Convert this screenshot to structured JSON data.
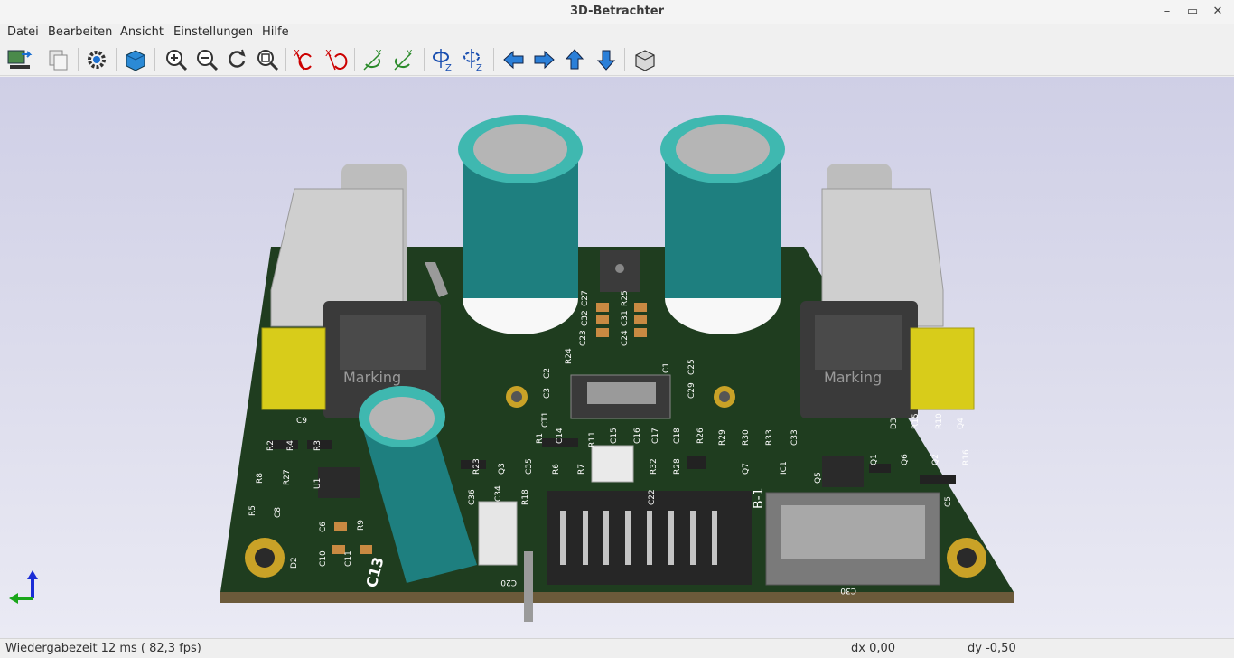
{
  "window": {
    "title": "3D-Betrachter"
  },
  "menu": [
    "Datei",
    "Bearbeiten",
    "Ansicht",
    "Einstellungen",
    "Hilfe"
  ],
  "toolbar": {
    "buttons": [
      "reload-board-icon",
      "copy-image-icon",
      "settings-icon",
      "render-mode-icon",
      "zoom-in-icon",
      "zoom-out-icon",
      "redraw-icon",
      "zoom-fit-icon",
      "rotate-x-cw-icon",
      "rotate-x-ccw-icon",
      "rotate-y-cw-icon",
      "rotate-y-ccw-icon",
      "rotate-z-cw-icon",
      "rotate-z-ccw-icon",
      "pan-left-icon",
      "pan-right-icon",
      "pan-up-icon",
      "pan-down-icon",
      "orthographic-icon"
    ]
  },
  "board": {
    "marking_left": "Marking",
    "marking_right": "Marking",
    "labels": [
      "C9",
      "C13",
      "C20",
      "C22",
      "C36",
      "R2",
      "R4",
      "R3",
      "R8",
      "R27",
      "R5",
      "C8",
      "C6",
      "R9",
      "D2",
      "C10",
      "C11",
      "U1",
      "R23",
      "Q3",
      "R18",
      "C34",
      "C35",
      "R6",
      "R7",
      "R1",
      "C14",
      "R11",
      "C15",
      "C16",
      "C17",
      "C18",
      "R26",
      "R29",
      "R30",
      "R33",
      "C33",
      "R32",
      "R28",
      "Q7",
      "IC1",
      "Q5",
      "D3",
      "R15",
      "R10",
      "Q4",
      "Q1",
      "Q6",
      "Q2",
      "R16",
      "C5",
      "C23",
      "C32",
      "C27",
      "C24",
      "C31",
      "R25",
      "R24",
      "C1",
      "C2",
      "C3",
      "C29",
      "C25",
      "CT1",
      "C30",
      "B-1"
    ]
  },
  "status": {
    "render_time": "Wiedergabezeit 12 ms ( 82,3 fps)",
    "dx": "dx 0,00",
    "dy": "dy -0,50"
  },
  "colors": {
    "pcb": "#1f3d1f",
    "capacitor": "#1e7f7f",
    "capacitor_ring": "#3fb8b0",
    "pad": "#d4a017",
    "viewport_top": "#cfcfe6",
    "viewport_bottom": "#eaeaf4"
  }
}
